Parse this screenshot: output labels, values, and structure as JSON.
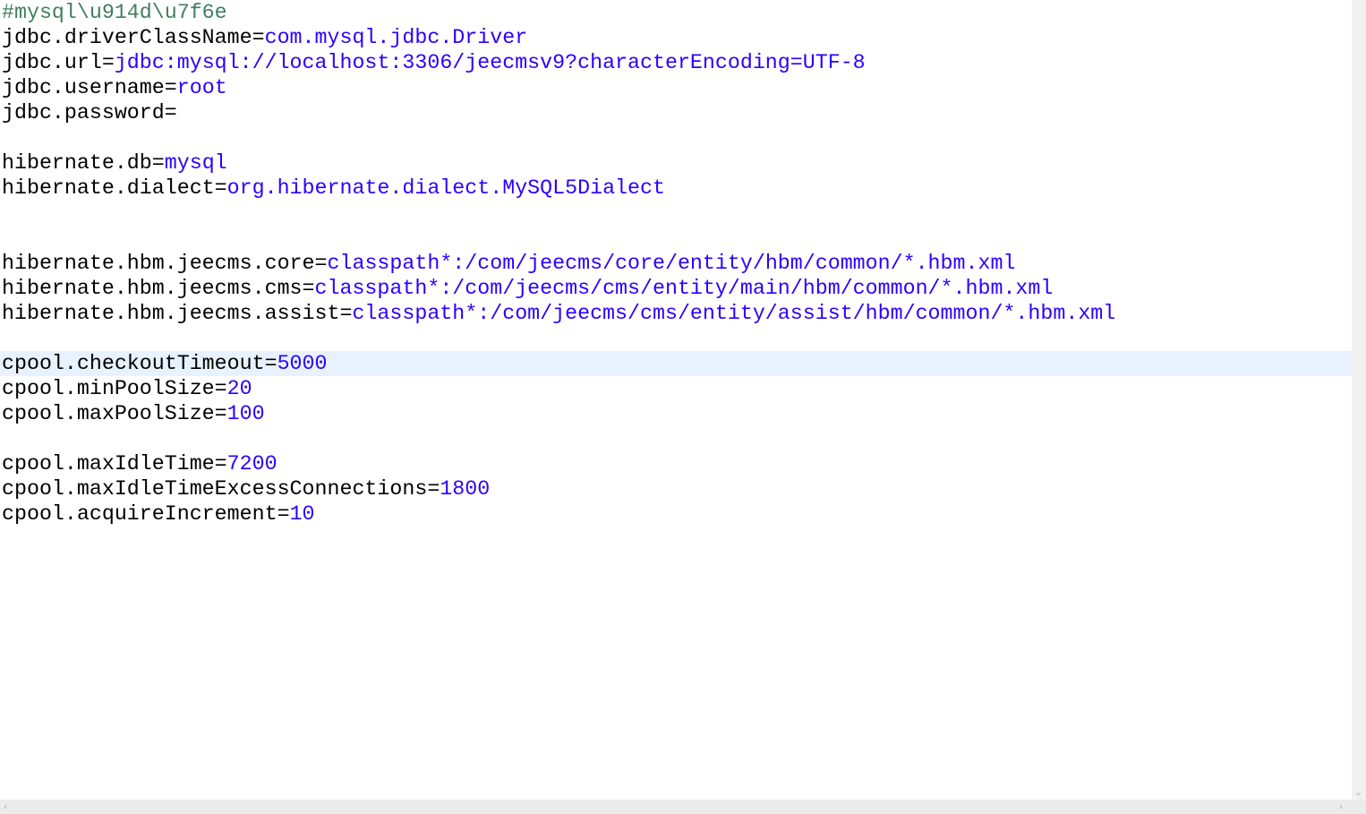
{
  "editor": {
    "current_line": 14,
    "lines": [
      {
        "comment": "#mysql\\u914d\\u7f6e"
      },
      {
        "key": "jdbc.driverClassName=",
        "value": "com.mysql.jdbc.Driver"
      },
      {
        "key": "jdbc.url=",
        "value": "jdbc:mysql://localhost:3306/jeecmsv9?characterEncoding=UTF-8"
      },
      {
        "key": "jdbc.username=",
        "value": "root"
      },
      {
        "key": "jdbc.password=",
        "value": ""
      },
      {},
      {
        "key": "hibernate.db=",
        "value": "mysql"
      },
      {
        "key": "hibernate.dialect=",
        "value": "org.hibernate.dialect.MySQL5Dialect"
      },
      {},
      {},
      {
        "key": "hibernate.hbm.jeecms.core=",
        "value": "classpath*:/com/jeecms/core/entity/hbm/common/*.hbm.xml"
      },
      {
        "key": "hibernate.hbm.jeecms.cms=",
        "value": "classpath*:/com/jeecms/cms/entity/main/hbm/common/*.hbm.xml"
      },
      {
        "key": "hibernate.hbm.jeecms.assist=",
        "value": "classpath*:/com/jeecms/cms/entity/assist/hbm/common/*.hbm.xml"
      },
      {},
      {
        "key": "cpool.checkoutTimeout=",
        "value": "5000"
      },
      {
        "key": "cpool.minPoolSize=",
        "value": "20"
      },
      {
        "key": "cpool.maxPoolSize=",
        "value": "100"
      },
      {},
      {
        "key": "cpool.maxIdleTime=",
        "value": "7200"
      },
      {
        "key": "cpool.maxIdleTimeExcessConnections=",
        "value": "1800"
      },
      {
        "key": "cpool.acquireIncrement=",
        "value": "10"
      }
    ]
  },
  "icons": {
    "scroll_down": "chevron-down-icon",
    "scroll_left": "chevron-left-icon",
    "scroll_right": "chevron-right-icon"
  }
}
